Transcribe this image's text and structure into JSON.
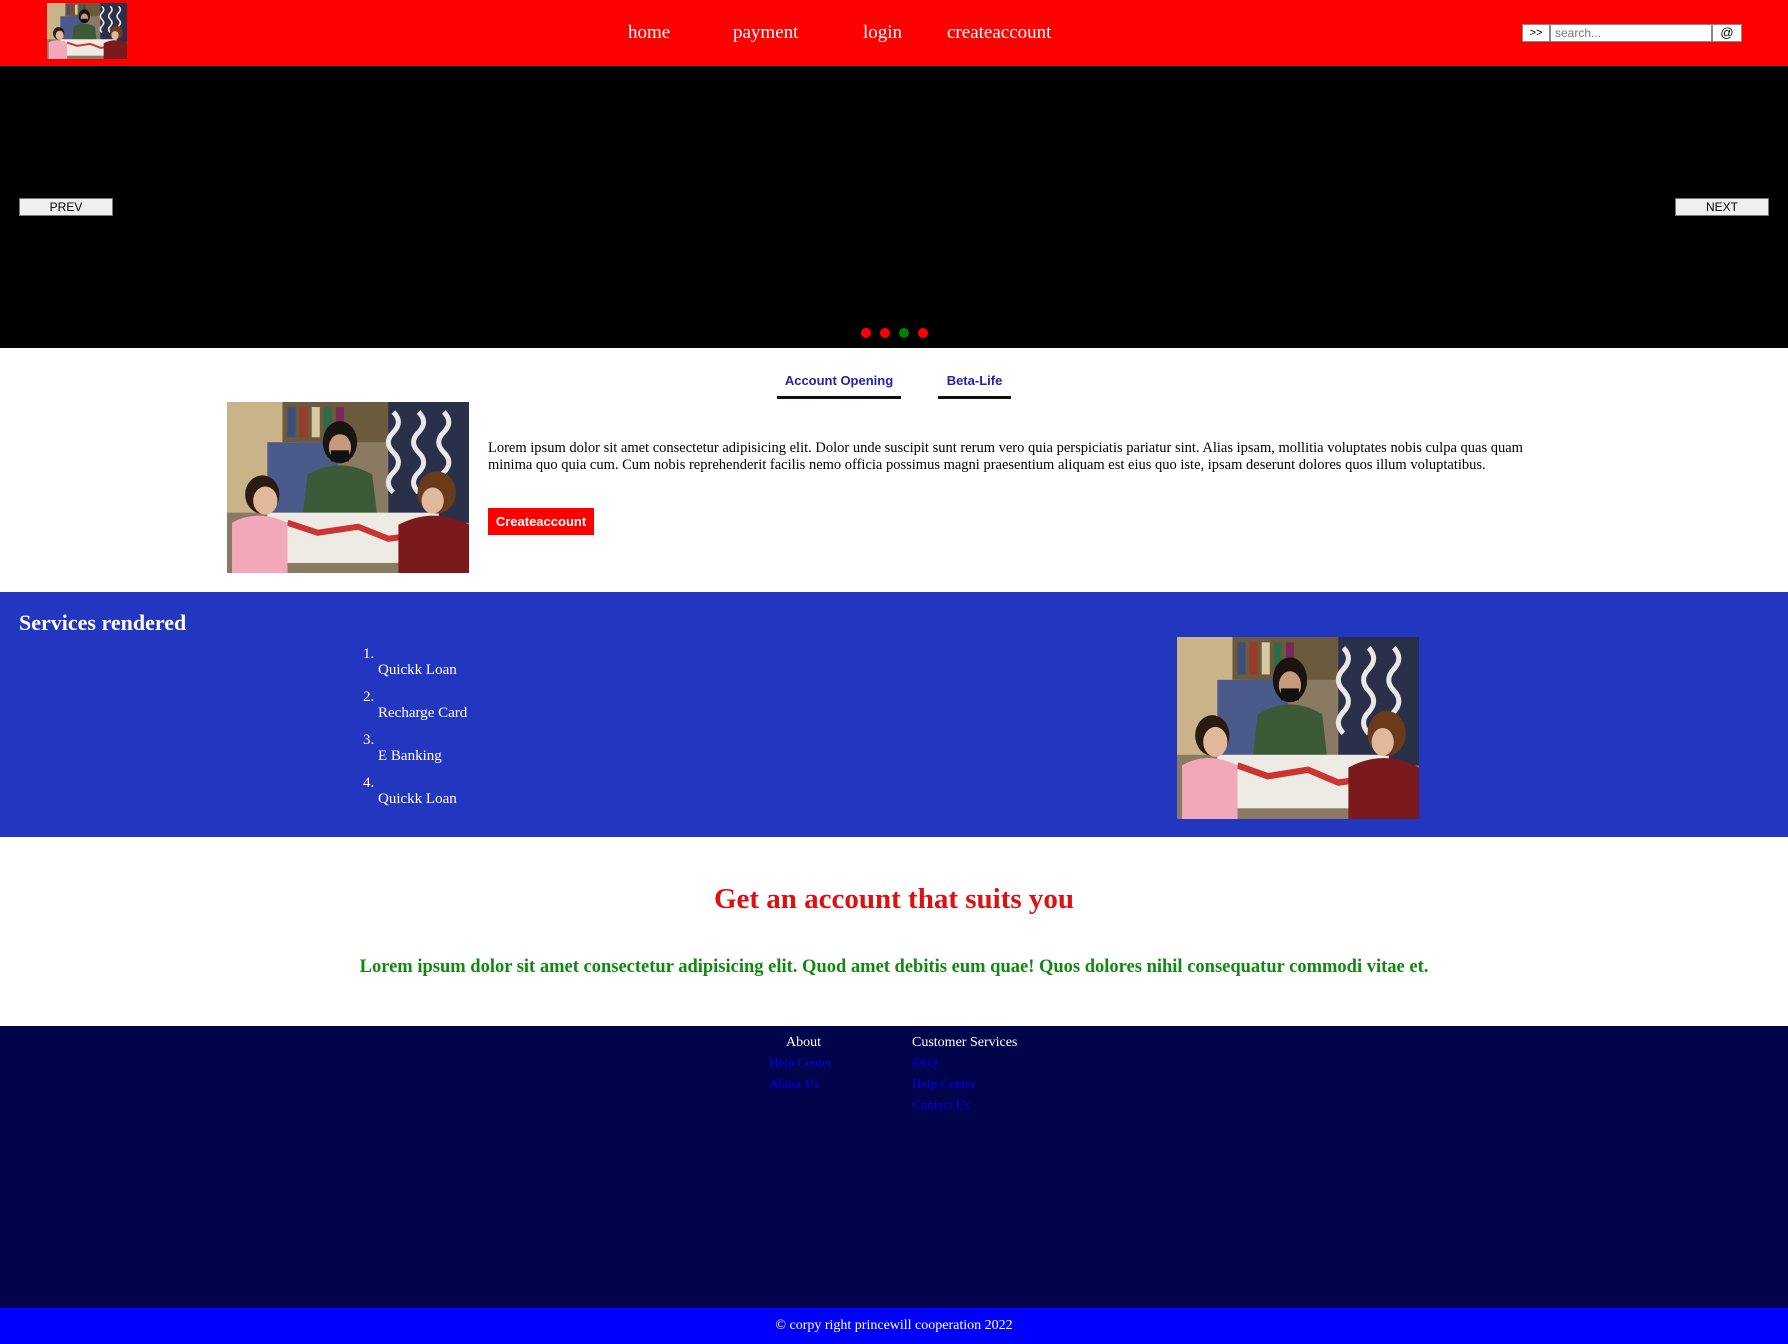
{
  "header": {
    "nav": [
      "home",
      "payment",
      "login",
      "createaccount"
    ],
    "search": {
      "go_label": ">>",
      "placeholder": "search...",
      "at_label": "@"
    }
  },
  "slider": {
    "prev_label": "PREV",
    "next_label": "NEXT",
    "dot_colors": [
      "#ff0000",
      "#ff0000",
      "#008000",
      "#ff0000"
    ]
  },
  "tabs": [
    "Account Opening",
    "Beta-Life"
  ],
  "intro": {
    "text": "Lorem ipsum dolor sit amet consectetur adipisicing elit. Dolor unde suscipit sunt rerum vero quia perspiciatis pariatur sint. Alias ipsam, mollitia voluptates nobis culpa quas quam minima quo quia cum. Cum nobis reprehenderit facilis nemo officia possimus magni praesentium aliquam est eius quo iste, ipsam deserunt dolores quos illum voluptatibus.",
    "button_label": "Createaccount"
  },
  "services": {
    "title": "Services rendered",
    "items": [
      {
        "num": "1.",
        "label": "Quickk Loan"
      },
      {
        "num": "2.",
        "label": "Recharge Card"
      },
      {
        "num": "3.",
        "label": "E Banking"
      },
      {
        "num": "4.",
        "label": "Quickk Loan"
      }
    ]
  },
  "promo": {
    "title": "Get an account that suits you",
    "text": "Lorem ipsum dolor sit amet consectetur adipisicing elit. Quod amet debitis eum quae! Quos dolores nihil consequatur commodi vitae et."
  },
  "footer": {
    "about": {
      "title": "About",
      "links": [
        "Help Center",
        "About Us"
      ]
    },
    "customer": {
      "title": "Customer Services",
      "links": [
        "FAQ",
        "Help Center",
        "Contact Us"
      ]
    },
    "copyright": "© corpy right princewill cooperation 2022"
  },
  "colors": {
    "header_bg": "#ff0000",
    "services_bg": "#2236bf",
    "footer_bg": "#00044a",
    "copyright_bg": "#0000ff"
  }
}
